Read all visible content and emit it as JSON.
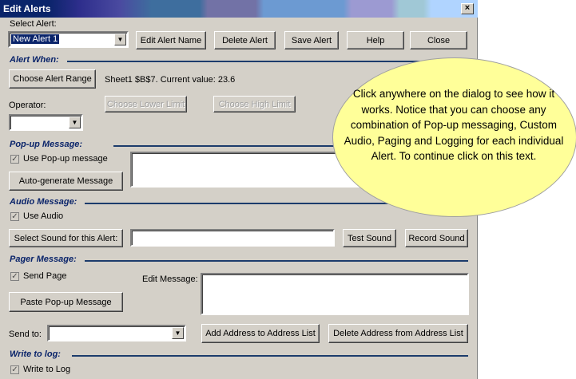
{
  "window": {
    "title": "Edit Alerts",
    "close_glyph": "×"
  },
  "select_alert": {
    "label": "Select Alert:",
    "value": "New Alert 1"
  },
  "toolbar": {
    "edit_name": "Edit Alert Name",
    "delete": "Delete Alert",
    "save": "Save Alert",
    "help": "Help",
    "close": "Close"
  },
  "alert_when": {
    "header": "Alert When:",
    "choose_range": "Choose Alert Range",
    "range_info": "Sheet1 $B$7. Current value: 23.6",
    "operator_label": "Operator:",
    "operator_value": "",
    "lower_limit": "Choose Lower Limit",
    "high_limit": "Choose High Limit"
  },
  "popup": {
    "header": "Pop-up Message:",
    "use_label": "Use Pop-up message",
    "use_checked": true,
    "auto_generate": "Auto-generate Message",
    "message": ""
  },
  "audio": {
    "header": "Audio Message:",
    "use_label": "Use Audio",
    "use_checked": true,
    "select_sound": "Select Sound for this Alert:",
    "sound_path": "",
    "test_sound": "Test Sound",
    "record_sound": "Record Sound"
  },
  "pager": {
    "header": "Pager Message:",
    "send_label": "Send Page",
    "send_checked": true,
    "edit_message_label": "Edit Message:",
    "paste_popup": "Paste Pop-up Message",
    "send_to_label": "Send to:",
    "send_to_value": "",
    "add_address": "Add Address to Address List",
    "delete_address": "Delete Address from Address List"
  },
  "log": {
    "header": "Write to log:",
    "write_label": "Write to Log",
    "write_checked": true
  },
  "tooltip": {
    "text": "Click anywhere on the dialog to see how it works. Notice that you can choose any combination of Pop-up messaging, Custom Audio, Paging and Logging for each individual Alert.  To continue click on this text."
  },
  "colors": {
    "title_bar": "#0a246a",
    "dialog_bg": "#d4d0c8",
    "tooltip_bg": "#ffff99",
    "section_header": "#0a246a"
  },
  "icons": {
    "dropdown": "chevron-down-icon",
    "checkbox": "checkmark-icon",
    "close": "close-icon"
  }
}
